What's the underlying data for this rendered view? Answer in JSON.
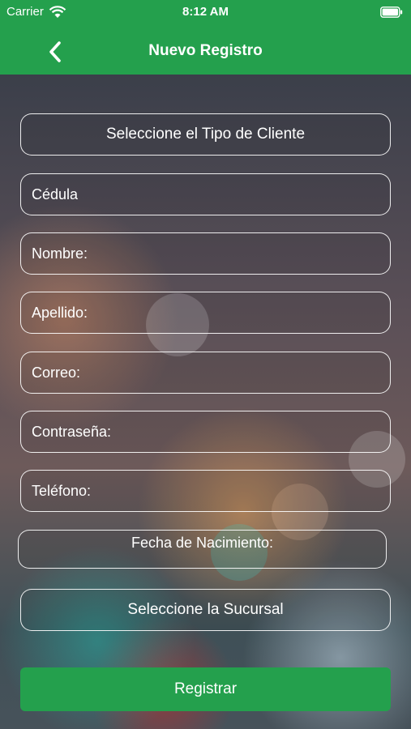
{
  "status_bar": {
    "carrier": "Carrier",
    "time": "8:12 AM"
  },
  "header": {
    "title": "Nuevo Registro"
  },
  "form": {
    "client_type": "Seleccione el Tipo de Cliente",
    "cedula": "Cédula",
    "nombre": "Nombre:",
    "apellido": "Apellido:",
    "correo": "Correo:",
    "contrasena": "Contraseña:",
    "telefono": "Teléfono:",
    "fecha_nacimiento": "Fecha de Nacimiento:",
    "sucursal": "Seleccione la Sucursal",
    "submit": "Registrar"
  },
  "colors": {
    "accent": "#24a04d"
  },
  "icons": [
    "wifi-icon",
    "battery-icon",
    "back-chevron-icon"
  ]
}
